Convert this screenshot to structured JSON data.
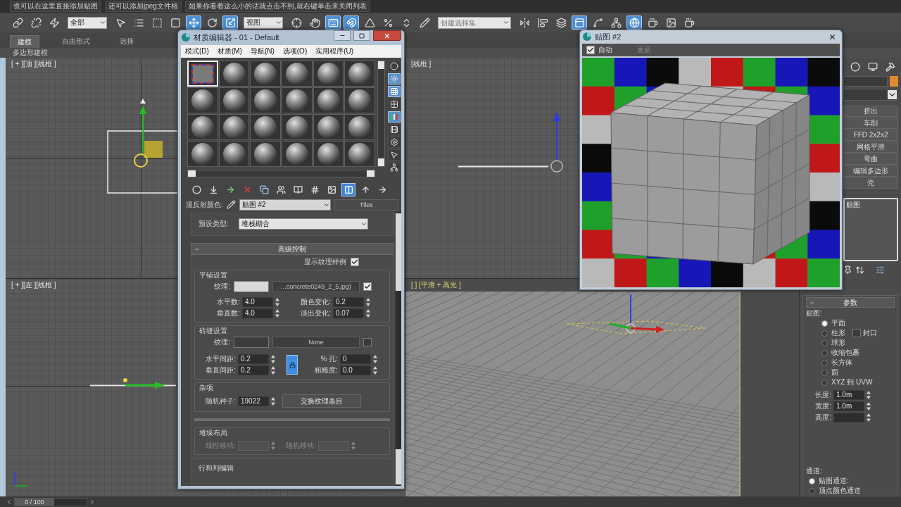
{
  "hint_bar": [
    "也可以在这里直接添加贴图",
    "还可以添加jpeg文件格",
    "如果你看着这么小的话就点击不到,就右键单击来关闭列表"
  ],
  "toolbar": [
    {
      "kind": "link",
      "selected": false
    },
    {
      "kind": "unlink",
      "selected": false
    },
    {
      "kind": "bind",
      "selected": false
    },
    {
      "kind": "dropdown",
      "value": "全部"
    },
    {
      "kind": "select",
      "selected": false
    },
    {
      "kind": "select_by_name",
      "selected": false
    },
    {
      "kind": "region",
      "selected": false
    },
    {
      "kind": "crossing",
      "selected": false
    },
    {
      "kind": "move",
      "selected": true
    },
    {
      "kind": "rotate",
      "selected": false
    },
    {
      "kind": "scale",
      "selected": true
    },
    {
      "kind": "dropdown",
      "value": "视图"
    },
    {
      "kind": "pivot",
      "selected": false
    },
    {
      "kind": "manipulate",
      "selected": false
    },
    {
      "kind": "keyboard",
      "selected": true
    },
    {
      "kind": "snap",
      "selected": true
    },
    {
      "kind": "angle_snap",
      "selected": false
    },
    {
      "kind": "percent_snap",
      "selected": false
    },
    {
      "kind": "spinner_snap",
      "selected": false
    },
    {
      "kind": "edit_sets",
      "selected": false
    },
    {
      "kind": "combo",
      "placeholder": "创建选择集"
    },
    {
      "kind": "mirror",
      "selected": false
    },
    {
      "kind": "align",
      "selected": false
    },
    {
      "kind": "layers",
      "selected": false
    },
    {
      "kind": "ribbon",
      "selected": true
    },
    {
      "kind": "curve_editor",
      "selected": false
    },
    {
      "kind": "schematic",
      "selected": false
    },
    {
      "kind": "material_editor",
      "selected": true
    },
    {
      "kind": "render_setup",
      "selected": false
    },
    {
      "kind": "frame_window",
      "selected": false
    },
    {
      "kind": "render",
      "selected": false
    }
  ],
  "ribbon": {
    "tabs": [
      {
        "label": "建模",
        "selected": true
      },
      {
        "label": "自由形式",
        "selected": false
      },
      {
        "label": "选择",
        "selected": false
      }
    ],
    "panel_label": "多边形建模"
  },
  "viewports": [
    {
      "kind": "top",
      "label": "[ + ][顶 ][线框 ]"
    },
    {
      "kind": "front",
      "label": "[线框 ]"
    },
    {
      "kind": "left",
      "label": "[ + ][左 ][线框 ]"
    },
    {
      "kind": "perspective",
      "label": "[ ] [平滑 + 高光 ]"
    }
  ],
  "material_editor": {
    "title": "材质编辑器 - 01 - Default",
    "menus": [
      "模式(D)",
      "材质(M)",
      "导航(N)",
      "选项(O)",
      "实用程序(U)"
    ],
    "slots": [
      {
        "kind": "tiles",
        "selected": true
      },
      {
        "kind": "sphere",
        "selected": false
      },
      {
        "kind": "sphere",
        "selected": false
      },
      {
        "kind": "sphere",
        "selected": false
      },
      {
        "kind": "sphere",
        "selected": false
      },
      {
        "kind": "sphere",
        "selected": false
      },
      {
        "kind": "sphere",
        "selected": false
      },
      {
        "kind": "sphere",
        "selected": false
      },
      {
        "kind": "sphere",
        "selected": false
      },
      {
        "kind": "sphere",
        "selected": false
      },
      {
        "kind": "sphere",
        "selected": false
      },
      {
        "kind": "sphere",
        "selected": false
      },
      {
        "kind": "sphere",
        "selected": false
      },
      {
        "kind": "sphere",
        "selected": false
      },
      {
        "kind": "sphere",
        "selected": false
      },
      {
        "kind": "sphere",
        "selected": false
      },
      {
        "kind": "sphere",
        "selected": false
      },
      {
        "kind": "sphere",
        "selected": false
      },
      {
        "kind": "sphere",
        "selected": false
      },
      {
        "kind": "sphere",
        "selected": false
      },
      {
        "kind": "sphere",
        "selected": false
      },
      {
        "kind": "sphere",
        "selected": false
      },
      {
        "kind": "sphere",
        "selected": false
      },
      {
        "kind": "sphere",
        "selected": false
      }
    ],
    "side_tools": [
      {
        "kind": "sample_type",
        "selected": false
      },
      {
        "kind": "backlight",
        "selected": true
      },
      {
        "kind": "background",
        "selected": true
      },
      {
        "kind": "uv_tiling",
        "selected": false
      },
      {
        "kind": "color_check",
        "selected": true
      },
      {
        "kind": "preview",
        "selected": false
      },
      {
        "kind": "options",
        "selected": false
      },
      {
        "kind": "select_by_material",
        "selected": false
      },
      {
        "kind": "navigator",
        "selected": false
      }
    ],
    "tools": [
      {
        "kind": "get_material",
        "selected": false
      },
      {
        "kind": "put_to_scene",
        "selected": false
      },
      {
        "kind": "assign",
        "selected": false
      },
      {
        "kind": "reset",
        "selected": false
      },
      {
        "kind": "copy",
        "selected": false
      },
      {
        "kind": "unique",
        "selected": false
      },
      {
        "kind": "library",
        "selected": false
      },
      {
        "kind": "effects",
        "selected": false
      },
      {
        "kind": "show_map",
        "selected": false
      },
      {
        "kind": "show_end",
        "selected": true
      },
      {
        "kind": "go_parent",
        "selected": false
      },
      {
        "kind": "go_sibling",
        "selected": false
      }
    ],
    "map_row": {
      "label": "漫反射颜色:",
      "map_name": "贴图 #2",
      "map_type": "Tiles"
    },
    "standard": {
      "label": "预设类型:",
      "value": "堆栈砌合"
    },
    "advanced": {
      "title": "高级控制",
      "show_swatches": {
        "label": "显示纹理样例",
        "checked": true
      },
      "tiles": {
        "title": "平铺设置",
        "texture_label": "纹理:",
        "color": "#d9d9d9",
        "map": "...concrete0249_2_5.jpg)",
        "checked": true,
        "fields": [
          {
            "label": "水平数:",
            "value": "4.0"
          },
          {
            "label": "颜色变化:",
            "value": "0.2"
          },
          {
            "label": "垂直数:",
            "value": "4.0"
          },
          {
            "label": "淡出变化:",
            "value": "0.07"
          }
        ]
      },
      "grout": {
        "title": "砖缝设置",
        "texture_label": "纹理:",
        "color": "#3c3c3c",
        "map": "None",
        "checked": false,
        "lock": true,
        "fields": [
          {
            "label": "水平间距:",
            "value": "0.2"
          },
          {
            "label": "% 孔:",
            "value": "0"
          },
          {
            "label": "垂直间距:",
            "value": "0.2"
          },
          {
            "label": "粗糙度:",
            "value": "0.0"
          }
        ]
      },
      "misc": {
        "title": "杂项",
        "seed_label": "随机种子:",
        "seed": "19022",
        "swap": "交换纹理条目"
      },
      "stacking": {
        "title": "堆垛布局",
        "fields": [
          {
            "label": "线性移动:",
            "disabled": true
          },
          {
            "label": "随机移动:",
            "disabled": true
          }
        ]
      },
      "row_column": {
        "title": "行和列编辑"
      }
    }
  },
  "render_window": {
    "title": "贴图 #2",
    "auto": {
      "label": "自动",
      "checked": true
    },
    "update": {
      "label": "更新",
      "disabled": true
    }
  },
  "command_panel": {
    "tabs": [
      {
        "kind": "motion"
      },
      {
        "kind": "display"
      },
      {
        "kind": "utilities"
      }
    ],
    "object_swatch": {
      "color": "#e0892e"
    },
    "modifiers": [
      "挤出",
      "车削",
      "FFD 2x2x2",
      "网格平滑",
      "弯曲",
      "编辑多边形",
      "壳"
    ],
    "stack": [
      "贴图"
    ],
    "params": {
      "title": "参数",
      "mapping_label": "贴图:",
      "options": [
        {
          "label": "平面",
          "selected": true
        },
        {
          "label": "柱形",
          "selected": false,
          "cap": {
            "label": "封口",
            "checked": false
          }
        },
        {
          "label": "球形",
          "selected": false
        },
        {
          "label": "收缩包裹",
          "selected": false
        },
        {
          "label": "长方体",
          "selected": false
        },
        {
          "label": "面",
          "selected": false
        },
        {
          "label": "XYZ 到 UVW",
          "selected": false
        }
      ],
      "dims": [
        {
          "label": "长度:",
          "value": "1.0m"
        },
        {
          "label": "宽度:",
          "value": "1.0m"
        },
        {
          "label": "高度:"
        }
      ],
      "channel": {
        "label": "通道:",
        "options": [
          {
            "label": "贴图通道:",
            "selected": true
          },
          {
            "label": "顶点颜色通道",
            "selected": false
          }
        ]
      }
    }
  },
  "timeline": {
    "label": "0 / 100",
    "level": 0
  }
}
